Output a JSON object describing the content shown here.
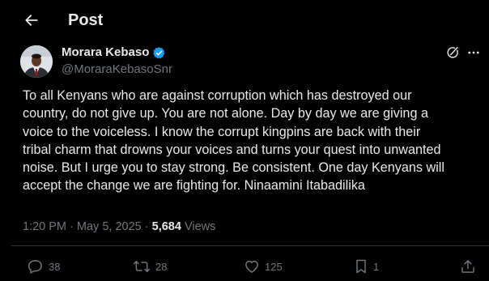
{
  "header": {
    "title": "Post",
    "back_icon": "arrow-left-icon"
  },
  "author": {
    "name": "Morara Kebaso",
    "handle": "@MoraraKebasoSnr",
    "verified_icon": "verified-badge-icon",
    "verified_color": "#1d9bf0"
  },
  "post": {
    "text": "To all Kenyans who are against corruption which has destroyed our\ncountry, do not give up. You are not alone. Day by day we are giving a\nvoice to the voiceless. I know the corrupt kingpins are back with their\ntribal charm that drowns your voices and turns your quest into unwanted\nnoise. But I urge you to stay strong. Be consistent. One day Kenyans will\naccept the change we are fighting for. Ninaamini Itabadilika",
    "time": "1:20 PM",
    "separator": "·",
    "date": "May 5, 2025",
    "views_count": "5,684",
    "views_label": "Views"
  },
  "actions": {
    "replies": "38",
    "reposts": "28",
    "likes": "125",
    "bookmarks": "1"
  },
  "icons": {
    "reply": "reply-icon",
    "repost": "repost-icon",
    "like": "heart-icon",
    "bookmark": "bookmark-icon",
    "share": "share-icon",
    "grok": "grok-icon",
    "more": "more-icon"
  },
  "colors": {
    "background": "#000000",
    "text": "#e7e9ea",
    "secondary": "#71767b",
    "divider": "#2f3336",
    "accent": "#1d9bf0"
  }
}
